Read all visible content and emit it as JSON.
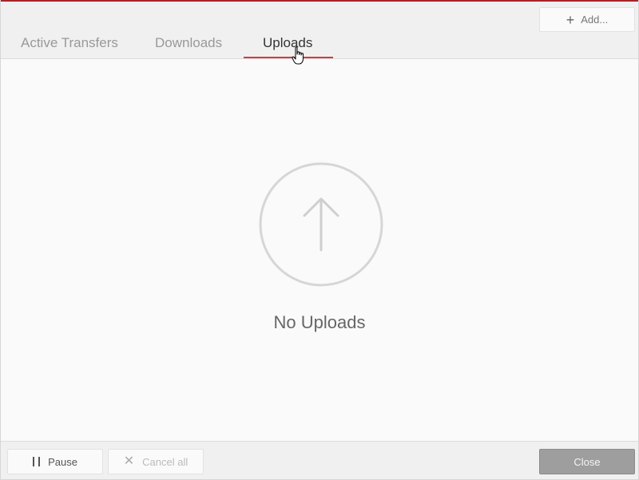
{
  "toolbar": {
    "add_label": "Add...",
    "add_icon": "plus-icon"
  },
  "tabs": [
    {
      "label": "Active Transfers",
      "active": false
    },
    {
      "label": "Downloads",
      "active": false
    },
    {
      "label": "Uploads",
      "active": true
    }
  ],
  "empty_state": {
    "icon": "upload-arrow-icon",
    "message": "No Uploads"
  },
  "footer": {
    "pause_label": "Pause",
    "cancel_all_label": "Cancel all",
    "close_label": "Close"
  },
  "colors": {
    "accent": "#d63a3f",
    "top_bar": "#a8242a"
  }
}
